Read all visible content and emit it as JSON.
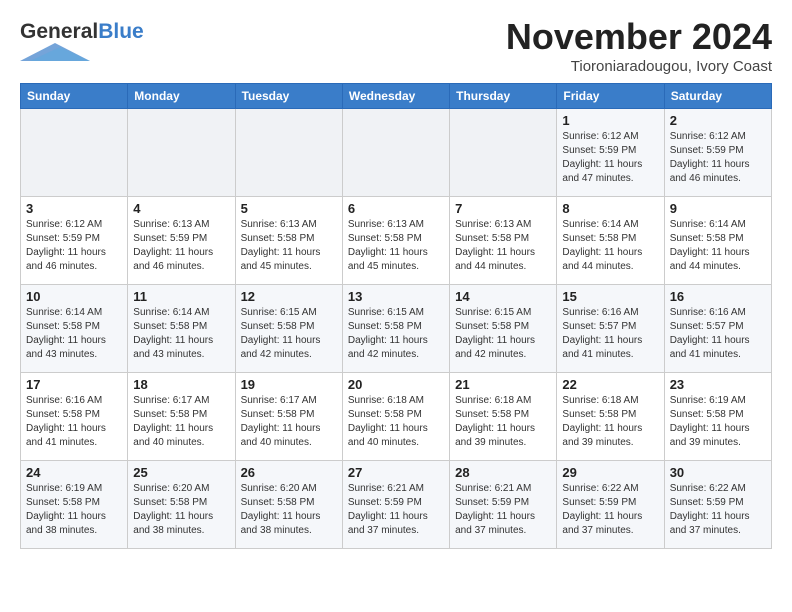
{
  "app": {
    "logo_general": "General",
    "logo_blue": "Blue",
    "title": "November 2024",
    "subtitle": "Tioroniaradougou, Ivory Coast"
  },
  "calendar": {
    "headers": [
      "Sunday",
      "Monday",
      "Tuesday",
      "Wednesday",
      "Thursday",
      "Friday",
      "Saturday"
    ],
    "rows": [
      [
        {
          "day": "",
          "detail": ""
        },
        {
          "day": "",
          "detail": ""
        },
        {
          "day": "",
          "detail": ""
        },
        {
          "day": "",
          "detail": ""
        },
        {
          "day": "",
          "detail": ""
        },
        {
          "day": "1",
          "detail": "Sunrise: 6:12 AM\nSunset: 5:59 PM\nDaylight: 11 hours and 47 minutes."
        },
        {
          "day": "2",
          "detail": "Sunrise: 6:12 AM\nSunset: 5:59 PM\nDaylight: 11 hours and 46 minutes."
        }
      ],
      [
        {
          "day": "3",
          "detail": "Sunrise: 6:12 AM\nSunset: 5:59 PM\nDaylight: 11 hours and 46 minutes."
        },
        {
          "day": "4",
          "detail": "Sunrise: 6:13 AM\nSunset: 5:59 PM\nDaylight: 11 hours and 46 minutes."
        },
        {
          "day": "5",
          "detail": "Sunrise: 6:13 AM\nSunset: 5:58 PM\nDaylight: 11 hours and 45 minutes."
        },
        {
          "day": "6",
          "detail": "Sunrise: 6:13 AM\nSunset: 5:58 PM\nDaylight: 11 hours and 45 minutes."
        },
        {
          "day": "7",
          "detail": "Sunrise: 6:13 AM\nSunset: 5:58 PM\nDaylight: 11 hours and 44 minutes."
        },
        {
          "day": "8",
          "detail": "Sunrise: 6:14 AM\nSunset: 5:58 PM\nDaylight: 11 hours and 44 minutes."
        },
        {
          "day": "9",
          "detail": "Sunrise: 6:14 AM\nSunset: 5:58 PM\nDaylight: 11 hours and 44 minutes."
        }
      ],
      [
        {
          "day": "10",
          "detail": "Sunrise: 6:14 AM\nSunset: 5:58 PM\nDaylight: 11 hours and 43 minutes."
        },
        {
          "day": "11",
          "detail": "Sunrise: 6:14 AM\nSunset: 5:58 PM\nDaylight: 11 hours and 43 minutes."
        },
        {
          "day": "12",
          "detail": "Sunrise: 6:15 AM\nSunset: 5:58 PM\nDaylight: 11 hours and 42 minutes."
        },
        {
          "day": "13",
          "detail": "Sunrise: 6:15 AM\nSunset: 5:58 PM\nDaylight: 11 hours and 42 minutes."
        },
        {
          "day": "14",
          "detail": "Sunrise: 6:15 AM\nSunset: 5:58 PM\nDaylight: 11 hours and 42 minutes."
        },
        {
          "day": "15",
          "detail": "Sunrise: 6:16 AM\nSunset: 5:57 PM\nDaylight: 11 hours and 41 minutes."
        },
        {
          "day": "16",
          "detail": "Sunrise: 6:16 AM\nSunset: 5:57 PM\nDaylight: 11 hours and 41 minutes."
        }
      ],
      [
        {
          "day": "17",
          "detail": "Sunrise: 6:16 AM\nSunset: 5:58 PM\nDaylight: 11 hours and 41 minutes."
        },
        {
          "day": "18",
          "detail": "Sunrise: 6:17 AM\nSunset: 5:58 PM\nDaylight: 11 hours and 40 minutes."
        },
        {
          "day": "19",
          "detail": "Sunrise: 6:17 AM\nSunset: 5:58 PM\nDaylight: 11 hours and 40 minutes."
        },
        {
          "day": "20",
          "detail": "Sunrise: 6:18 AM\nSunset: 5:58 PM\nDaylight: 11 hours and 40 minutes."
        },
        {
          "day": "21",
          "detail": "Sunrise: 6:18 AM\nSunset: 5:58 PM\nDaylight: 11 hours and 39 minutes."
        },
        {
          "day": "22",
          "detail": "Sunrise: 6:18 AM\nSunset: 5:58 PM\nDaylight: 11 hours and 39 minutes."
        },
        {
          "day": "23",
          "detail": "Sunrise: 6:19 AM\nSunset: 5:58 PM\nDaylight: 11 hours and 39 minutes."
        }
      ],
      [
        {
          "day": "24",
          "detail": "Sunrise: 6:19 AM\nSunset: 5:58 PM\nDaylight: 11 hours and 38 minutes."
        },
        {
          "day": "25",
          "detail": "Sunrise: 6:20 AM\nSunset: 5:58 PM\nDaylight: 11 hours and 38 minutes."
        },
        {
          "day": "26",
          "detail": "Sunrise: 6:20 AM\nSunset: 5:58 PM\nDaylight: 11 hours and 38 minutes."
        },
        {
          "day": "27",
          "detail": "Sunrise: 6:21 AM\nSunset: 5:59 PM\nDaylight: 11 hours and 37 minutes."
        },
        {
          "day": "28",
          "detail": "Sunrise: 6:21 AM\nSunset: 5:59 PM\nDaylight: 11 hours and 37 minutes."
        },
        {
          "day": "29",
          "detail": "Sunrise: 6:22 AM\nSunset: 5:59 PM\nDaylight: 11 hours and 37 minutes."
        },
        {
          "day": "30",
          "detail": "Sunrise: 6:22 AM\nSunset: 5:59 PM\nDaylight: 11 hours and 37 minutes."
        }
      ]
    ]
  }
}
